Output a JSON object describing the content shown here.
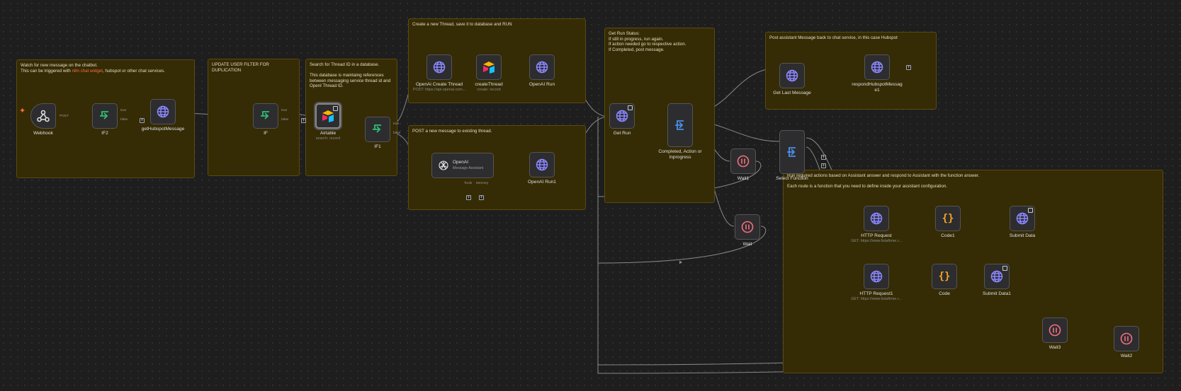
{
  "sticky_notes": {
    "watch": "Watch for new message on the chatbot.\nThis can be triggered with ",
    "watch_link": "n8n chat widget",
    "watch_tail": ", hubspot or other chat services.",
    "dedup": "UPDATE USER FILTER FOR DUPLICATION",
    "search": "Search for Thread ID in a database.\n\nThis database is maintaing references between messaging service thread id and OpenI Thread ID.",
    "create": "Create a new Thread, save it to database and RUN",
    "post": "POST a new message to existing thread.",
    "run_status": "Get Run Status:\nIf still in progress, run again.\nIf action needed go to respective action.\nIf Completed, post message.",
    "post_back": "Post assistant Message back to chat service, in this case Hubspot",
    "functions": "Run required actions based on Assistant answer and respond to Assistant with the function answer.\n\nEach route is a function that you need to define inside your assistant configuration."
  },
  "nodes": {
    "webhook": {
      "label": "Webhook",
      "icon": "webhook-icon"
    },
    "if2": {
      "label": "IF2",
      "icon": "if-icon"
    },
    "gethubspot": {
      "label": "getHubspotMessage",
      "icon": "globe-icon"
    },
    "if": {
      "label": "IF",
      "icon": "if-icon"
    },
    "airtable": {
      "label": "Airtable",
      "sub": "search: record",
      "icon": "airtable-icon"
    },
    "if1": {
      "label": "IF1",
      "icon": "if-icon"
    },
    "createthread_http": {
      "label": "OpenAi Create Thread",
      "sub": "POST: https://api.openai.com...",
      "icon": "globe-icon"
    },
    "createthread": {
      "label": "createThread",
      "sub": "create: record",
      "icon": "airtable-icon"
    },
    "openai_run": {
      "label": "OpenAI Run",
      "icon": "globe-icon"
    },
    "openai": {
      "label": "OpenAI",
      "sub": "Message Assistant",
      "icon": "openai-icon"
    },
    "openai_run1": {
      "label": "OpenAI Run1",
      "icon": "globe-icon"
    },
    "get_run": {
      "label": "Get Run",
      "icon": "globe-icon"
    },
    "completed": {
      "label": "Completed, Action or Inprogress",
      "icon": "switch-icon"
    },
    "get_last": {
      "label": "Get Last Message",
      "icon": "globe-icon"
    },
    "respond": {
      "label": "respondHubspotMessag e1",
      "icon": "globe-icon"
    },
    "wait1": {
      "label": "Wait1",
      "icon": "pause-icon"
    },
    "wait": {
      "label": "Wait",
      "icon": "pause-icon"
    },
    "select_fn": {
      "label": "Select Function",
      "icon": "switch-icon"
    },
    "http": {
      "label": "HTTP Request",
      "sub": "GET: https://www.listafirme.r...",
      "icon": "globe-icon"
    },
    "code1": {
      "label": "Code1",
      "icon": "code-icon"
    },
    "submit": {
      "label": "Submit Data",
      "icon": "globe-icon"
    },
    "http1": {
      "label": "HTTP Request1",
      "sub": "GET: https://www.listafirme.r...",
      "icon": "globe-icon"
    },
    "code": {
      "label": "Code",
      "icon": "code-icon"
    },
    "submit1": {
      "label": "Submit Data1",
      "icon": "globe-icon"
    },
    "wait3": {
      "label": "Wait3",
      "icon": "pause-icon"
    },
    "wait2": {
      "label": "Wait2",
      "icon": "pause-icon"
    }
  },
  "edge_labels": {
    "post": "POST",
    "true": "true",
    "false": "false",
    "tools": "Tools",
    "memory": "Memory"
  },
  "colors": {
    "accent": "#ff6d3a",
    "globe": "#8b87ff",
    "if": "#2fbf71",
    "switch": "#4a8fe8",
    "wait": "#f36f7f",
    "code": "#f5a623"
  }
}
